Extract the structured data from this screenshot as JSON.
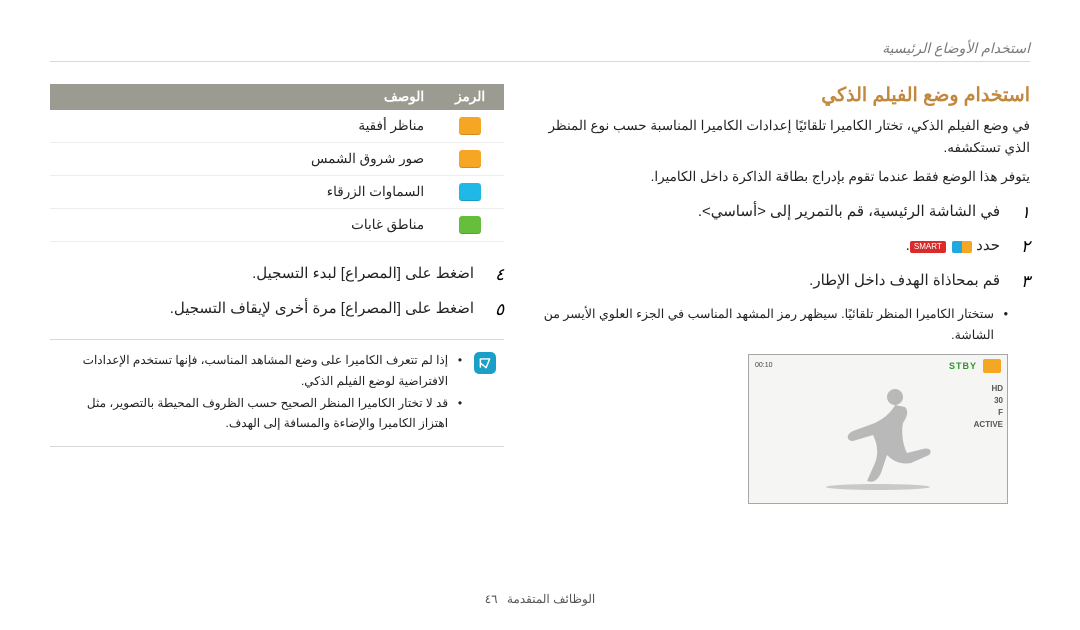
{
  "breadcrumb": "استخدام الأوضاع الرئيسية",
  "title": "استخدام وضع الفيلم الذكي",
  "intro1": "في وضع الفيلم الذكي، تختار الكاميرا تلقائيًا إعدادات الكاميرا المناسبة حسب نوع المنظر الذي تستكشفه.",
  "intro2": "يتوفر هذا الوضع فقط عندما تقوم بإدراج بطاقة الذاكرة داخل الكاميرا.",
  "steps_r": [
    {
      "num": "١",
      "text": "في الشاشة الرئيسية، قم بالتمرير إلى <أساسي>."
    },
    {
      "num": "٢",
      "text": "حدد"
    },
    {
      "num": "٣",
      "text": "قم بمحاذاة الهدف داخل الإطار."
    }
  ],
  "sub_bullet_r": "ستختار الكاميرا المنظر تلقائيًا. سيظهر رمز المشهد المناسب في الجزء العلوي الأيسر من الشاشة.",
  "smart_label": "SMART",
  "preview": {
    "stby": "STBY",
    "time": "00:10",
    "hd": "HD",
    "fps": "30",
    "f": "F",
    "active": "ACTIVE"
  },
  "table": {
    "head_icon": "الرمز",
    "head_desc": "الوصف",
    "rows": [
      {
        "desc": "مناظر أفقية"
      },
      {
        "desc": "صور شروق الشمس"
      },
      {
        "desc": "السماوات الزرقاء"
      },
      {
        "desc": "مناطق غابات"
      }
    ]
  },
  "steps_l": [
    {
      "num": "٤",
      "text": "اضغط على [المصراع] لبدء التسجيل."
    },
    {
      "num": "٥",
      "text": "اضغط على [المصراع] مرة أخرى لإيقاف التسجيل."
    }
  ],
  "info": [
    "إذا لم تتعرف الكاميرا على وضع المشاهد المناسب، فإنها تستخدم الإعدادات الافتراضية لوضع الفيلم الذكي.",
    "قد لا تختار الكاميرا المنظر الصحيح حسب الظروف المحيطة بالتصوير، مثل اهتزاز الكاميرا والإضاءة والمسافة إلى الهدف."
  ],
  "footer_label": "الوظائف المتقدمة",
  "footer_page": "٤٦"
}
